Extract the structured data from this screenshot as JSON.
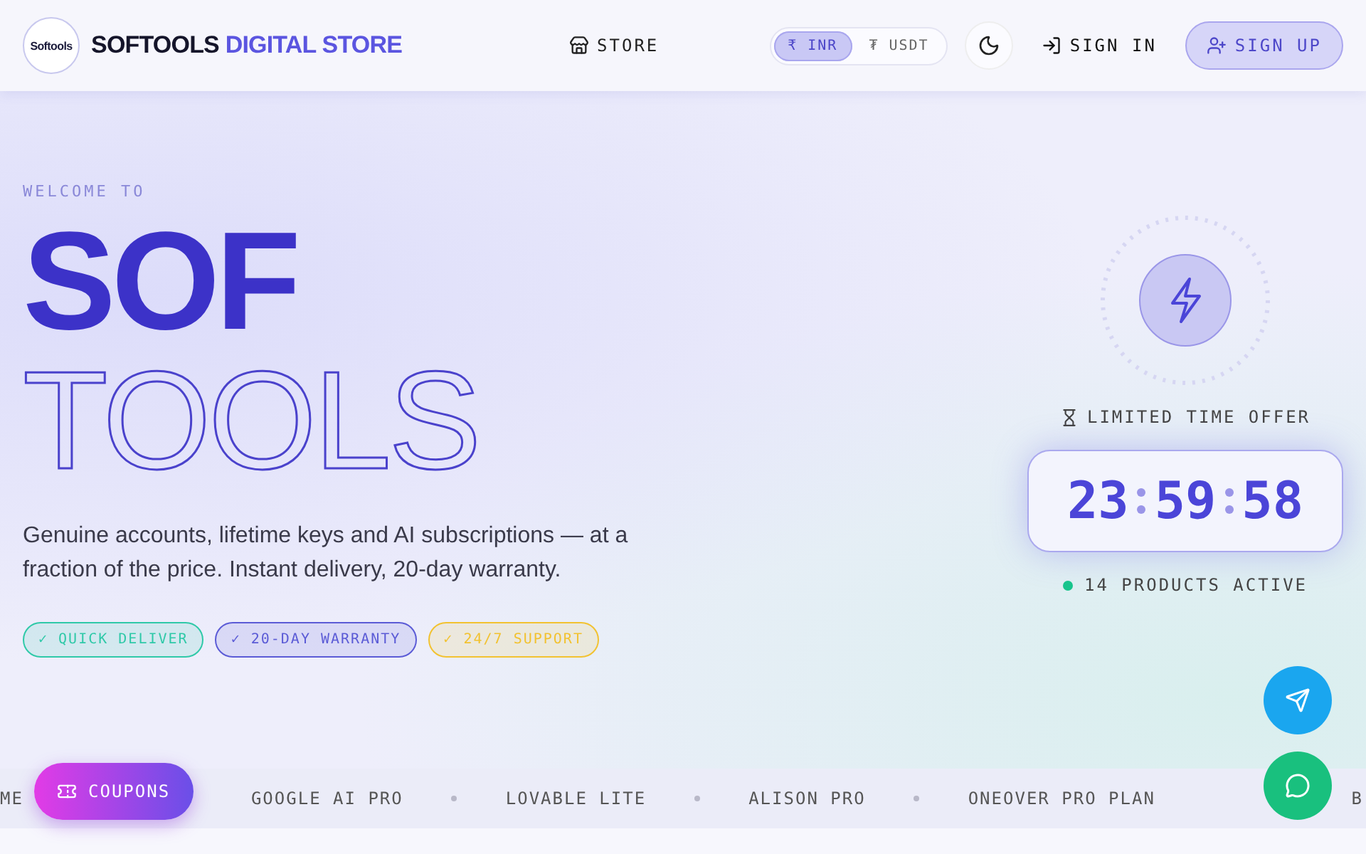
{
  "header": {
    "logo_text": "Softools",
    "brand": "SOFTOOLS",
    "brand_accent": "DIGITAL STORE",
    "nav": [
      {
        "label": "STORE"
      }
    ],
    "currencies": [
      {
        "symbol": "₹",
        "label": "INR",
        "selected": true
      },
      {
        "symbol": "₮",
        "label": "USDT",
        "selected": false
      }
    ],
    "sign_in": "SIGN IN",
    "sign_up": "SIGN UP"
  },
  "hero": {
    "eyebrow": "WELCOME TO",
    "title_solid": "SOF",
    "title_outline": "TOOLS",
    "description": "Genuine accounts, lifetime keys and AI subscriptions — at a fraction of the price. Instant delivery, 20-day warranty.",
    "chips": [
      {
        "label": "✓ QUICK DELIVER",
        "color": "#2fc9a8"
      },
      {
        "label": "✓ 20-DAY WARRANTY",
        "color": "#5b5bd6"
      },
      {
        "label": "✓ 24/7 SUPPORT",
        "color": "#f2c230"
      }
    ]
  },
  "offer": {
    "label": "LIMITED TIME OFFER",
    "hours": "23",
    "minutes": "59",
    "seconds": "58",
    "status": "14 PRODUCTS ACTIVE"
  },
  "marquee": [
    "ME",
    "GOOGLE AI PRO",
    "LOVABLE LITE",
    "ALISON PRO",
    "ONEOVER PRO PLAN",
    "B"
  ],
  "coupons_button": "COUPONS"
}
